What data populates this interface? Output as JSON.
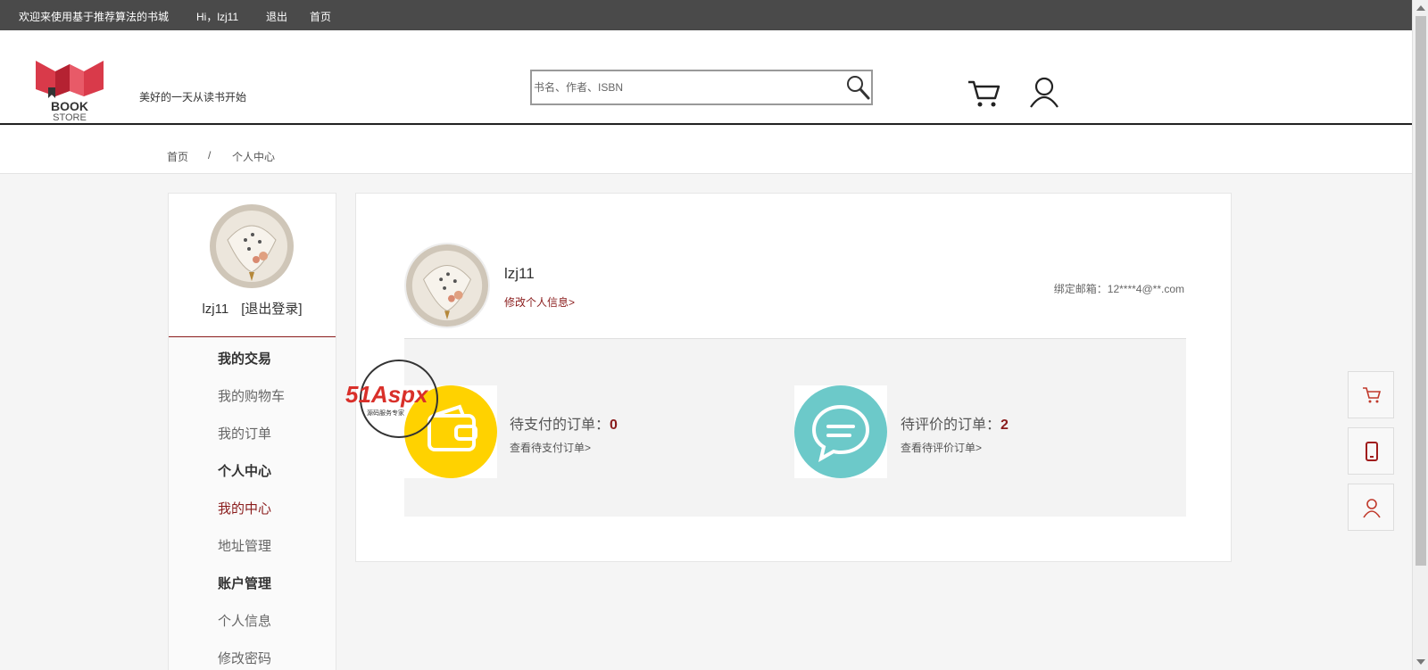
{
  "topbar": {
    "welcome": "欢迎来使用基于推荐算法的书城",
    "greeting": "Hi，lzj11",
    "logout": "退出",
    "home": "首页"
  },
  "header": {
    "logo_text_top": "BOOK",
    "logo_text_bottom": "STORE",
    "slogan": "美好的一天从读书开始",
    "search_placeholder": "书名、作者、ISBN"
  },
  "breadcrumb": {
    "home": "首页",
    "separator": "/",
    "current": "个人中心"
  },
  "sidebar": {
    "username": "lzj11",
    "logout_link": "[退出登录]",
    "sections": [
      {
        "title": "我的交易",
        "items": [
          "我的购物车",
          "我的订单"
        ]
      },
      {
        "title": "个人中心",
        "items": [
          "我的中心",
          "地址管理"
        ]
      },
      {
        "title": "账户管理",
        "items": [
          "个人信息",
          "修改密码"
        ]
      }
    ],
    "active_item": "我的中心"
  },
  "main": {
    "username": "lzj11",
    "edit_profile": "修改个人信息>",
    "email_label": "绑定邮箱：12****4@**.com",
    "pending_payment": {
      "label": "待支付的订单：",
      "count": "0",
      "link": "查看待支付订单>"
    },
    "pending_review": {
      "label": "待评价的订单：",
      "count": "2",
      "link": "查看待评价订单>"
    }
  },
  "watermark": {
    "brand": "51Aspx",
    "tagline": "源码服务专家"
  },
  "colors": {
    "accent": "#8a1c1c",
    "topbar": "#4a4a4a",
    "wallet_yellow": "#ffd200",
    "chat_teal": "#6cc9c9"
  },
  "icons": [
    "search-icon",
    "cart-icon",
    "user-icon",
    "wallet-icon",
    "chat-icon",
    "phone-icon"
  ]
}
